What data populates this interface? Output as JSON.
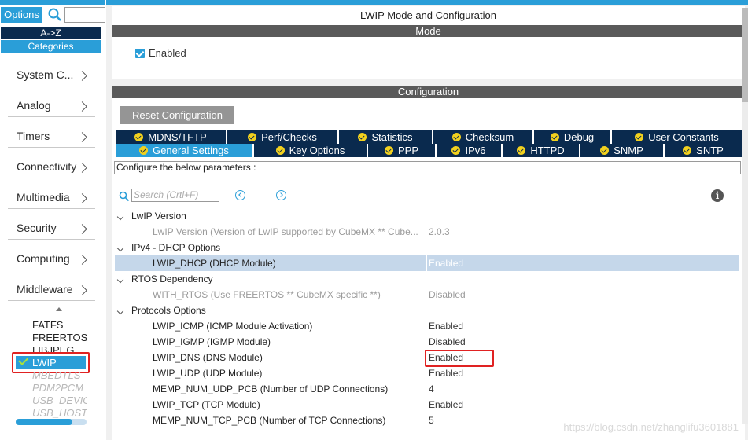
{
  "left": {
    "options_label": "Options",
    "sort_label": "A->Z",
    "categories_label": "Categories",
    "categories": [
      "System C...",
      "Analog",
      "Timers",
      "Connectivity",
      "Multimedia",
      "Security",
      "Computing",
      "Middleware"
    ],
    "middleware": [
      "FATFS",
      "FREERTOS",
      "LIBJPEG",
      "LWIP",
      "MBEDTLS",
      "PDM2PCM",
      "USB_DEVICE",
      "USB_HOST"
    ],
    "selected": "LWIP"
  },
  "header": {
    "title": "LWIP Mode and Configuration",
    "mode_label": "Mode",
    "mode_enabled_label": "Enabled",
    "config_label": "Configuration"
  },
  "config": {
    "reset_label": "Reset Configuration",
    "tabs_row1": [
      "MDNS/TFTP",
      "Perf/Checks",
      "Statistics",
      "Checksum",
      "Debug",
      "User Constants"
    ],
    "tabs_row2": [
      "General Settings",
      "Key Options",
      "PPP",
      "IPv6",
      "HTTPD",
      "SNMP",
      "SNTP"
    ],
    "active_tab": "General Settings",
    "description": "Configure the below parameters :",
    "search_placeholder": "Search (Crtl+F)",
    "groups": [
      {
        "title": "LwIP Version",
        "params": [
          {
            "name": "LwIP Version (Version of LwIP supported by CubeMX ** Cube...",
            "value": "2.0.3",
            "state": "disabled"
          }
        ]
      },
      {
        "title": "IPv4 - DHCP Options",
        "params": [
          {
            "name": "LWIP_DHCP (DHCP Module)",
            "value": "Enabled",
            "state": "selected"
          }
        ]
      },
      {
        "title": "RTOS Dependency",
        "params": [
          {
            "name": "WITH_RTOS (Use FREERTOS ** CubeMX specific **)",
            "value": "Disabled",
            "state": "disabled"
          }
        ]
      },
      {
        "title": "Protocols Options",
        "params": [
          {
            "name": "LWIP_ICMP (ICMP Module Activation)",
            "value": "Enabled",
            "state": "normal"
          },
          {
            "name": "LWIP_IGMP (IGMP Module)",
            "value": "Disabled",
            "state": "normal"
          },
          {
            "name": "LWIP_DNS (DNS Module)",
            "value": "Enabled",
            "state": "normal"
          },
          {
            "name": "LWIP_UDP (UDP Module)",
            "value": "Enabled",
            "state": "normal"
          },
          {
            "name": "MEMP_NUM_UDP_PCB (Number of UDP Connections)",
            "value": "4",
            "state": "normal"
          },
          {
            "name": "LWIP_TCP (TCP Module)",
            "value": "Enabled",
            "state": "normal"
          },
          {
            "name": "MEMP_NUM_TCP_PCB (Number of TCP Connections)",
            "value": "5",
            "state": "normal"
          }
        ]
      }
    ]
  },
  "watermark": "https://blog.csdn.net/zhanglifu3601881",
  "colors": {
    "accent": "#2a9ed8",
    "dark_tab": "#0a2a4e",
    "section_header": "#5a5a5a",
    "highlight": "#e02222"
  }
}
